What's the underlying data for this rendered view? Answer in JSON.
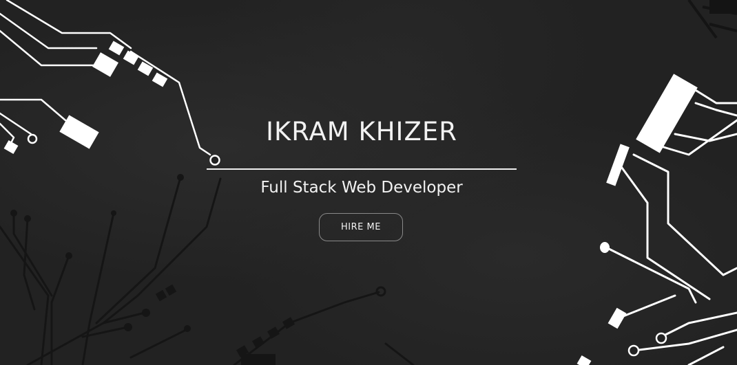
{
  "hero": {
    "name": "IKRAM KHIZER",
    "subtitle": "Full Stack Web Developer",
    "cta_label": "HIRE ME"
  },
  "theme": {
    "background": "#242424",
    "text_color": "#f2f2f2",
    "circuit_light": "#ffffff",
    "circuit_dark": "#141414",
    "button_border": "#8a8a8a"
  },
  "decorations": {
    "background_motif": "circuit-board-traces"
  }
}
